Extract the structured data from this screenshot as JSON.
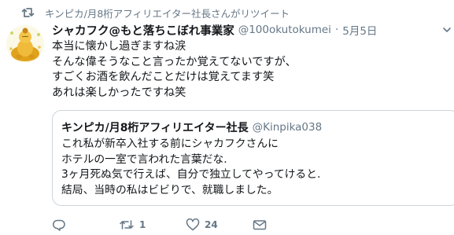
{
  "retweet_context": {
    "text": "キンピカ/月8桁アフィリエイター社長さんがリツイート"
  },
  "tweet": {
    "display_name": "シャカフク@もと落ちこぼれ事業家",
    "handle": "@100okutokumei",
    "separator": "·",
    "timestamp": "5月5日",
    "lines": [
      "本当に懐かし過ぎますね涙",
      "そんな偉そうなこと言ったか覚えてないですが、",
      "すごくお酒を飲んだことだけは覚えてます笑",
      "あれは楽しかったですね笑"
    ]
  },
  "quote": {
    "display_name": "キンピカ/月8桁アフィリエイター社長",
    "handle": "@Kinpika038",
    "lines": [
      "これ私が新卒入社する前にシャカフクさんに",
      "ホテルの一室で言われた言葉だな.",
      "3ヶ月死ぬ気で行えば、自分で独立してやってけると.",
      "結局、当時の私はビビりで、就職しました。"
    ]
  },
  "actions": {
    "reply_count": "",
    "retweet_count": "1",
    "like_count": "24"
  },
  "icons": {
    "retweet": "retweet-icon",
    "avatar": "buddha-avatar",
    "more": "chevron-down-icon",
    "reply": "reply-icon",
    "like": "heart-icon",
    "dm": "envelope-icon"
  },
  "colors": {
    "text": "#14171a",
    "secondary": "#657786",
    "border": "#ccd6dd"
  }
}
